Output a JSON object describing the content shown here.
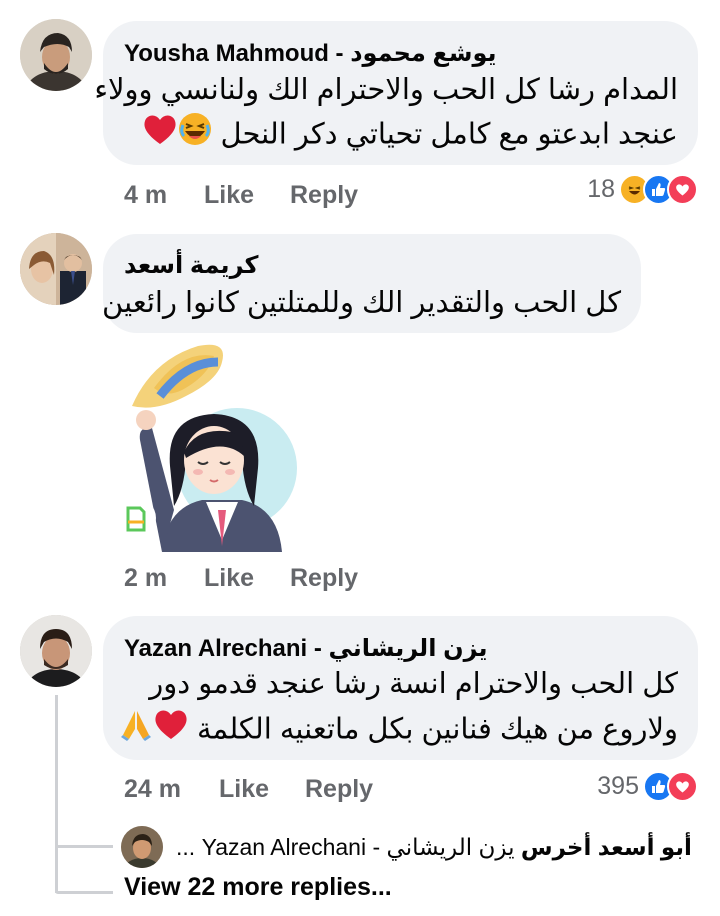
{
  "comments": [
    {
      "name": "Yousha Mahmoud - يوشع محمود",
      "lines": [
        "المدام رشا كل الحب والاحترام الك ولنانسي وولاء",
        "عنجد ابدعتو مع كامل تحياتي دكر النحل"
      ],
      "time": "4 m",
      "like": "Like",
      "reply": "Reply",
      "reaction_count": "18",
      "reaction_icons": [
        "haha-reaction-icon",
        "like-reaction-icon",
        "love-reaction-icon"
      ]
    },
    {
      "name": "كريمة أسعد",
      "lines": [
        "كل الحب والتقدير الك وللمتلتين كانوا رائعين"
      ],
      "time": "2 m",
      "like": "Like",
      "reply": "Reply",
      "sticker": "girl-tipping-hat-sticker"
    },
    {
      "name": "Yazan Alrechani - يزن الريشاني",
      "lines": [
        "كل الحب والاحترام انسة رشا عنجد قدمو دور",
        "ولاروع من هيك فنانين بكل ماتعنيه الكلمة"
      ],
      "time": "24 m",
      "like": "Like",
      "reply": "Reply",
      "reaction_count": "395",
      "reaction_icons": [
        "like-reaction-icon",
        "love-reaction-icon"
      ]
    }
  ],
  "reply_preview": {
    "author": "أبو أسعد أخرس",
    "text": "يزن الريشاني - Yazan Alrechani ..."
  },
  "view_more": "View 22 more replies...",
  "colors": {
    "bubble": "#f0f2f5",
    "meta": "#65676b",
    "like_blue": "#1877f2",
    "love_red": "#f33e58",
    "haha_yellow": "#f7b125"
  }
}
